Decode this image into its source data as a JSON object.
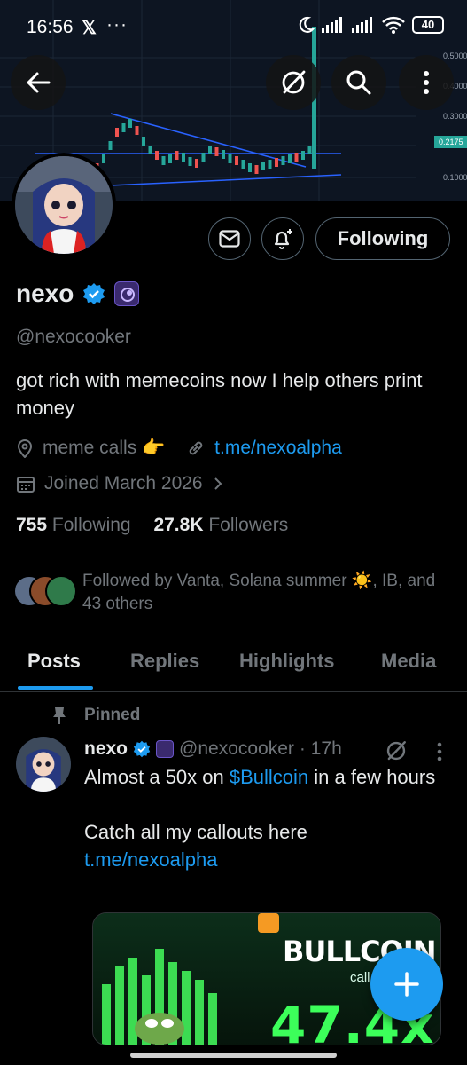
{
  "status_bar": {
    "time": "16:56",
    "battery": "40"
  },
  "chart_labels": [
    "0.5000",
    "0.4000",
    "0.3000",
    "0.2175",
    "0.1000"
  ],
  "profile": {
    "name": "nexo",
    "handle": "@nexocooker",
    "bio": "got rich with memecoins now I help others print money",
    "location": "meme calls 👉",
    "website": "t.me/nexoalpha",
    "joined": "Joined March 2026",
    "following_count": "755",
    "following_label": "Following",
    "followers_count": "27.8K",
    "followers_label": "Followers",
    "follow_button": "Following",
    "followed_by": "Followed by Vanta, Solana summer ☀️, IB, and 43 others"
  },
  "tabs": [
    "Posts",
    "Replies",
    "Highlights",
    "Media"
  ],
  "pinned_label": "Pinned",
  "tweet": {
    "name": "nexo",
    "handle": "@nexocooker",
    "time": "· 17h",
    "line1_pre": "Almost a 50x on ",
    "line1_link": "$Bullcoin",
    "line1_post": " in a few hours",
    "line2_pre": "Catch all my callouts here ",
    "line2_link": "t.me/nexoalpha"
  },
  "media_card": {
    "title": "BULLCOIN",
    "sub": "call",
    "multiplier": "47.4x"
  },
  "colors": {
    "accent": "#1d9bf0",
    "chart_up": "#26a69a",
    "chart_down": "#ef5350",
    "background": "#000000"
  }
}
